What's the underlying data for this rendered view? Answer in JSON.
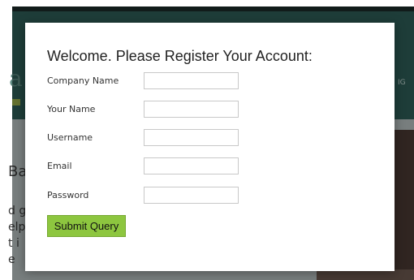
{
  "background": {
    "logo_letter": "a",
    "nav_item": "IG",
    "hero_title": "Ba",
    "hero_lines": [
      "d g",
      "elp",
      "t i",
      "e"
    ]
  },
  "modal": {
    "title": "Welcome. Please Register Your Account:",
    "fields": [
      {
        "label": "Company Name",
        "value": ""
      },
      {
        "label": "Your Name",
        "value": ""
      },
      {
        "label": "Username",
        "value": ""
      },
      {
        "label": "Email",
        "value": ""
      },
      {
        "label": "Password",
        "value": ""
      }
    ],
    "submit_label": "Submit Query"
  },
  "colors": {
    "header": "#2f5f58",
    "submit_button": "#8dc63f"
  }
}
